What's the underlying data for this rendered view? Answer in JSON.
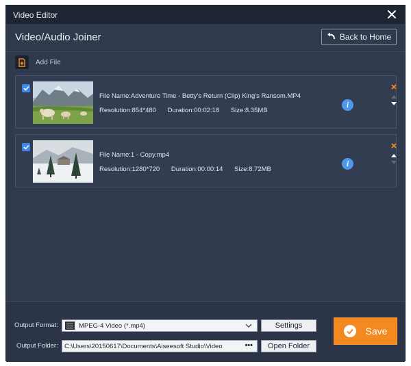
{
  "window": {
    "title": "Video Editor"
  },
  "header": {
    "title": "Video/Audio Joiner",
    "back_label": "Back to Home"
  },
  "toolbar": {
    "add_file_label": "Add File"
  },
  "files": [
    {
      "checked": true,
      "name_text": "File Name:Adventure Time - Betty's Return (Clip) King's Ransom.MP4",
      "resolution_text": "Resolution:854*480",
      "duration_text": "Duration:00:02:18",
      "size_text": "Size:8.35MB"
    },
    {
      "checked": true,
      "name_text": "File Name:1 - Copy.mp4",
      "resolution_text": "Resolution:1280*720",
      "duration_text": "Duration:00:00:14",
      "size_text": "Size:8.72MB"
    }
  ],
  "output": {
    "format_label": "Output Format:",
    "format_value": "MPEG-4 Video (*.mp4)",
    "settings_label": "Settings",
    "folder_label": "Output Folder:",
    "folder_value": "C:\\Users\\20150617\\Documents\\Aiseesoft Studio\\Video",
    "browse_label": "•••",
    "open_folder_label": "Open Folder",
    "save_label": "Save"
  },
  "colors": {
    "background": "#2f3a4d",
    "titlebar": "#1e2634",
    "accent_orange": "#f48a1f",
    "check_blue": "#3e86e8",
    "info_blue": "#4d98ec"
  }
}
